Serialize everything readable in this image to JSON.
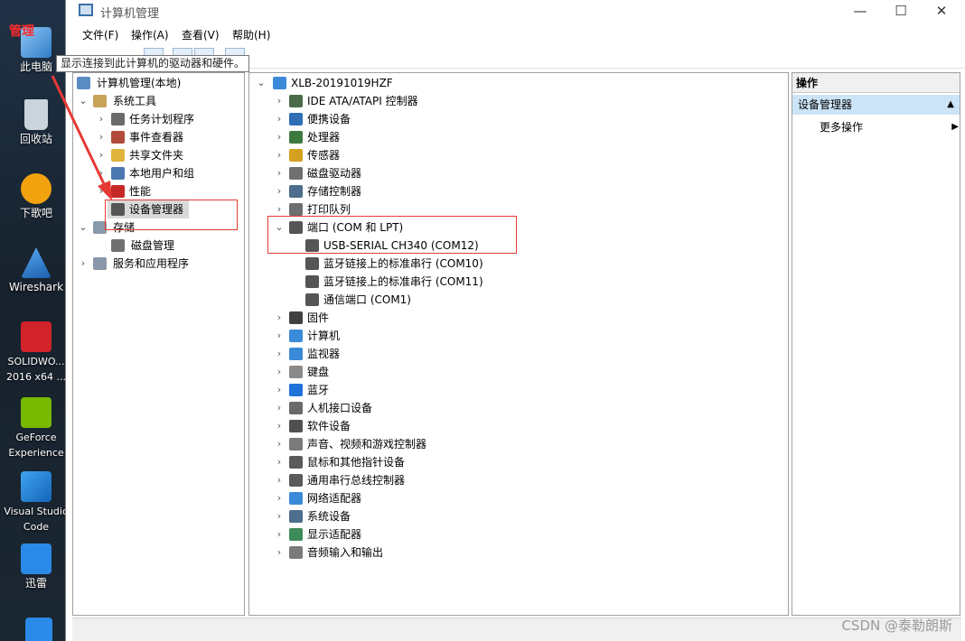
{
  "desktop": {
    "overlay_label": "管理",
    "icons": [
      {
        "label": "此电脑",
        "icon": "computer-icon",
        "color": "#3d8fd6"
      },
      {
        "label": "回收站",
        "icon": "recycle-bin-icon",
        "color": "#c9d4dc"
      },
      {
        "label": "下歌吧",
        "icon": "download-app-icon",
        "color": "#f2a20f"
      },
      {
        "label": "Wireshark",
        "icon": "wireshark-icon",
        "color": "#2a7bd6"
      },
      {
        "label": "SOLIDWO... 2016 x64 ...",
        "icon": "solidworks-icon",
        "color": "#d3232a"
      },
      {
        "label": "GeForce Experience",
        "icon": "geforce-icon",
        "color": "#76b900"
      },
      {
        "label": "Visual Studio Code",
        "icon": "vscode-icon",
        "color": "#1f8ad2"
      },
      {
        "label": "迅雷",
        "icon": "xunlei-icon",
        "color": "#2b89e8"
      }
    ]
  },
  "window": {
    "title": "计算机管理",
    "controls": [
      "—",
      "☐",
      "✕"
    ]
  },
  "menu": [
    "文件(F)",
    "操作(A)",
    "查看(V)",
    "帮助(H)"
  ],
  "tooltip": "显示连接到此计算机的驱动器和硬件。",
  "left_tree": {
    "root": "计算机管理(本地)",
    "system_tools": "系统工具",
    "items": [
      {
        "label": "任务计划程序",
        "icon": "clock-icon",
        "color": "#6a6a6a"
      },
      {
        "label": "事件查看器",
        "icon": "event-viewer-icon",
        "color": "#b04a3a"
      },
      {
        "label": "共享文件夹",
        "icon": "shared-folder-icon",
        "color": "#e0b43c"
      },
      {
        "label": "本地用户和组",
        "icon": "users-icon",
        "color": "#4b78b0"
      },
      {
        "label": "性能",
        "icon": "performance-icon",
        "color": "#c62828"
      },
      {
        "label": "设备管理器",
        "icon": "device-manager-icon",
        "color": "#555555"
      }
    ],
    "storage": "存储",
    "disk_management": "磁盘管理",
    "services": "服务和应用程序"
  },
  "device_tree": {
    "root": "XLB-20191019HZF",
    "categories": [
      {
        "label": "IDE ATA/ATAPI 控制器",
        "icon": "ide-controller-icon",
        "color": "#4a6b4a"
      },
      {
        "label": "便携设备",
        "icon": "portable-device-icon",
        "color": "#2f6db5"
      },
      {
        "label": "处理器",
        "icon": "processor-icon",
        "color": "#3d7a3d"
      },
      {
        "label": "传感器",
        "icon": "sensor-icon",
        "color": "#d4a020"
      },
      {
        "label": "磁盘驱动器",
        "icon": "disk-drive-icon",
        "color": "#707070"
      },
      {
        "label": "存储控制器",
        "icon": "storage-controller-icon",
        "color": "#4d6e8c"
      },
      {
        "label": "打印队列",
        "icon": "printer-icon",
        "color": "#6e6e6e"
      }
    ],
    "ports": {
      "label": "端口 (COM 和 LPT)",
      "children": [
        "USB-SERIAL CH340 (COM12)",
        "蓝牙链接上的标准串行 (COM10)",
        "蓝牙链接上的标准串行 (COM11)",
        "通信端口 (COM1)"
      ]
    },
    "categories_after": [
      {
        "label": "固件",
        "icon": "firmware-icon",
        "color": "#404040"
      },
      {
        "label": "计算机",
        "icon": "computer-icon",
        "color": "#3b8ad9"
      },
      {
        "label": "监视器",
        "icon": "monitor-icon",
        "color": "#3b8ad9"
      },
      {
        "label": "键盘",
        "icon": "keyboard-icon",
        "color": "#8a8a8a"
      },
      {
        "label": "蓝牙",
        "icon": "bluetooth-icon",
        "color": "#1e72d8"
      },
      {
        "label": "人机接口设备",
        "icon": "hid-icon",
        "color": "#6a6a6a"
      },
      {
        "label": "软件设备",
        "icon": "software-device-icon",
        "color": "#505050"
      },
      {
        "label": "声音、视频和游戏控制器",
        "icon": "speaker-icon",
        "color": "#7a7a7a"
      },
      {
        "label": "鼠标和其他指针设备",
        "icon": "mouse-icon",
        "color": "#5a5a5a"
      },
      {
        "label": "通用串行总线控制器",
        "icon": "usb-icon",
        "color": "#5a5a5a"
      },
      {
        "label": "网络适配器",
        "icon": "network-adapter-icon",
        "color": "#3b8ad9"
      },
      {
        "label": "系统设备",
        "icon": "system-device-icon",
        "color": "#4d6e8c"
      },
      {
        "label": "显示适配器",
        "icon": "display-adapter-icon",
        "color": "#3d8a5a"
      },
      {
        "label": "音频输入和输出",
        "icon": "audio-io-icon",
        "color": "#7a7a7a"
      }
    ]
  },
  "actions": {
    "header": "操作",
    "section": "设备管理器",
    "more": "更多操作"
  },
  "watermark": "CSDN @泰勒朗斯",
  "colors": {
    "highlight": "#e53935",
    "selection": "#cce4f7"
  }
}
